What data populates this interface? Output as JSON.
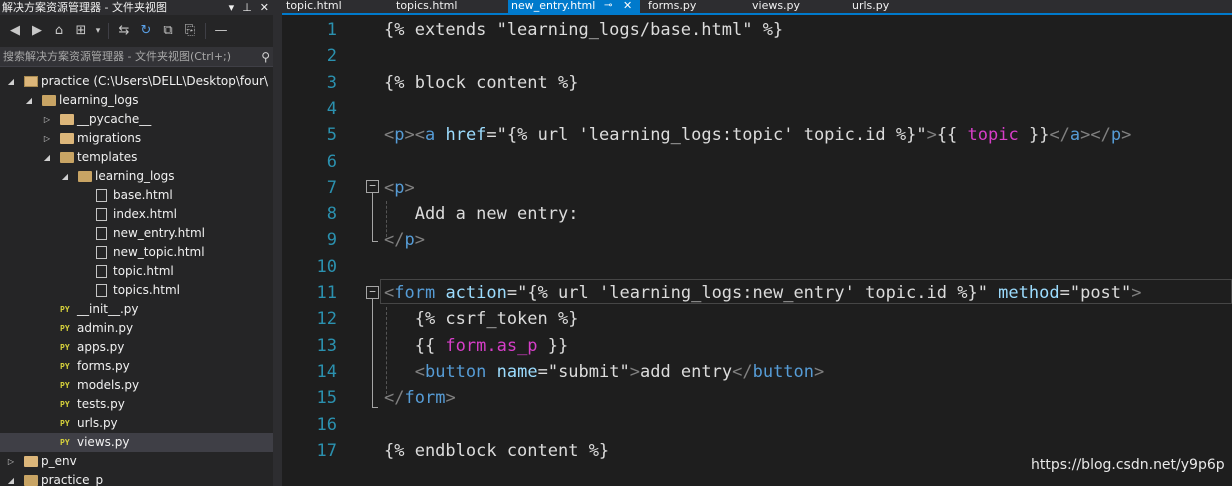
{
  "explorer": {
    "title": "解决方案资源管理器 - 文件夹视图",
    "title_buttons": [
      "▾",
      "⊥",
      "✕"
    ],
    "search_placeholder": "搜索解决方案资源管理器 - 文件夹视图(Ctrl+;)",
    "toolbar": [
      "◀",
      "▶",
      "⌂",
      "⊞",
      "▾",
      "⇆",
      "↻",
      "⧉",
      "⎘",
      "—"
    ],
    "tree": [
      {
        "label": "practice (C:\\Users\\DELL\\Desktop\\four\\",
        "type": "project",
        "expanded": true
      },
      {
        "label": "learning_logs",
        "type": "folder",
        "expanded": true
      },
      {
        "label": "__pycache__",
        "type": "folder",
        "expanded": false
      },
      {
        "label": "migrations",
        "type": "folder",
        "expanded": false
      },
      {
        "label": "templates",
        "type": "folder",
        "expanded": true
      },
      {
        "label": "learning_logs",
        "type": "folder",
        "expanded": true
      },
      {
        "label": "base.html",
        "type": "html"
      },
      {
        "label": "index.html",
        "type": "html"
      },
      {
        "label": "new_entry.html",
        "type": "html"
      },
      {
        "label": "new_topic.html",
        "type": "html"
      },
      {
        "label": "topic.html",
        "type": "html"
      },
      {
        "label": "topics.html",
        "type": "html"
      },
      {
        "label": "__init__.py",
        "type": "py"
      },
      {
        "label": "admin.py",
        "type": "py"
      },
      {
        "label": "apps.py",
        "type": "py"
      },
      {
        "label": "forms.py",
        "type": "py"
      },
      {
        "label": "models.py",
        "type": "py"
      },
      {
        "label": "tests.py",
        "type": "py"
      },
      {
        "label": "urls.py",
        "type": "py"
      },
      {
        "label": "views.py",
        "type": "py",
        "selected": true
      },
      {
        "label": "p_env",
        "type": "folder",
        "expanded": false
      },
      {
        "label": "practice_p",
        "type": "folder",
        "expanded": true
      }
    ]
  },
  "tabs": [
    {
      "label": "topic.html",
      "active": false
    },
    {
      "label": "topics.html",
      "active": false
    },
    {
      "label": "new_entry.html",
      "active": true
    },
    {
      "label": "forms.py",
      "active": false
    },
    {
      "label": "views.py",
      "active": false
    },
    {
      "label": "urls.py",
      "active": false
    }
  ],
  "tab_icons": {
    "pin": "⊸",
    "close": "✕"
  },
  "editor": {
    "line_numbers": [
      "1",
      "2",
      "3",
      "4",
      "5",
      "6",
      "7",
      "8",
      "9",
      "10",
      "11",
      "12",
      "13",
      "14",
      "15",
      "16",
      "17"
    ],
    "fold_markers": {
      "open": "−"
    },
    "lines": [
      [
        [
          "t-plain",
          "{% extends \"learning_logs/base.html\" %}"
        ]
      ],
      [],
      [
        [
          "t-plain",
          "{% block content %}"
        ]
      ],
      [],
      [
        [
          "t-br",
          "<"
        ],
        [
          "t-tag",
          "p"
        ],
        [
          "t-br",
          "><"
        ],
        [
          "t-tag",
          "a "
        ],
        [
          "t-attr",
          "href"
        ],
        [
          "t-plain",
          "=\""
        ],
        [
          "t-str",
          "{% url 'learning_logs:topic' topic.id %}"
        ],
        [
          "t-plain",
          "\""
        ],
        [
          "t-br",
          ">"
        ],
        [
          "t-plain",
          "{{ "
        ],
        [
          "t-var",
          "topic"
        ],
        [
          "t-plain",
          " }}"
        ],
        [
          "t-br",
          "</"
        ],
        [
          "t-tag",
          "a"
        ],
        [
          "t-br",
          "></"
        ],
        [
          "t-tag",
          "p"
        ],
        [
          "t-br",
          ">"
        ]
      ],
      [],
      [
        [
          "t-br",
          "<"
        ],
        [
          "t-tag",
          "p"
        ],
        [
          "t-br",
          ">"
        ]
      ],
      [
        [
          "t-plain",
          "   Add a new entry:"
        ]
      ],
      [
        [
          "t-br",
          "</"
        ],
        [
          "t-tag",
          "p"
        ],
        [
          "t-br",
          ">"
        ]
      ],
      [],
      [
        [
          "t-br",
          "<"
        ],
        [
          "t-tag",
          "form "
        ],
        [
          "t-attr",
          "action"
        ],
        [
          "t-plain",
          "=\""
        ],
        [
          "t-str",
          "{% url 'learning_logs:new_entry' topic.id %}"
        ],
        [
          "t-plain",
          "\" "
        ],
        [
          "t-attr",
          "method"
        ],
        [
          "t-plain",
          "=\""
        ],
        [
          "t-str",
          "post"
        ],
        [
          "t-plain",
          "\""
        ],
        [
          "t-br",
          ">"
        ]
      ],
      [
        [
          "t-plain",
          "   {% csrf_token %}"
        ]
      ],
      [
        [
          "t-plain",
          "   {{ "
        ],
        [
          "t-var",
          "form.as_p"
        ],
        [
          "t-plain",
          " }}"
        ]
      ],
      [
        [
          "t-plain",
          "   "
        ],
        [
          "t-br",
          "<"
        ],
        [
          "t-tag",
          "button "
        ],
        [
          "t-attr",
          "name"
        ],
        [
          "t-plain",
          "=\""
        ],
        [
          "t-str",
          "submit"
        ],
        [
          "t-plain",
          "\""
        ],
        [
          "t-br",
          ">"
        ],
        [
          "t-plain",
          "add entry"
        ],
        [
          "t-br",
          "</"
        ],
        [
          "t-tag",
          "button"
        ],
        [
          "t-br",
          ">"
        ]
      ],
      [
        [
          "t-br",
          "</"
        ],
        [
          "t-tag",
          "form"
        ],
        [
          "t-br",
          ">"
        ]
      ],
      [],
      [
        [
          "t-plain",
          "{% endblock content %}"
        ]
      ]
    ]
  },
  "watermark": "https://blog.csdn.net/y9p6p"
}
